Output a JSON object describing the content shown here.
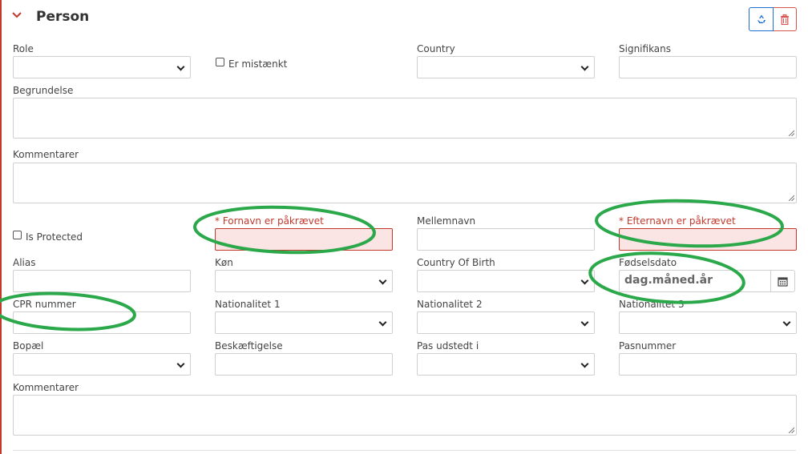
{
  "section": {
    "title": "Person"
  },
  "labels": {
    "role": "Role",
    "er_mistaenkt": "Er mistænkt",
    "country": "Country",
    "signifikans": "Signifikans",
    "begrundelse": "Begrundelse",
    "kommentarer_1": "Kommentarer",
    "is_protected": "Is Protected",
    "fornavn_required": "* Fornavn er påkrævet",
    "mellemnavn": "Mellemnavn",
    "efternavn_required": "* Efternavn er påkrævet",
    "alias": "Alias",
    "koen": "Køn",
    "country_of_birth": "Country Of Birth",
    "foedselsdato": "Fødselsdato",
    "cpr_nummer": "CPR nummer",
    "nationalitet_1": "Nationalitet 1",
    "nationalitet_2": "Nationalitet 2",
    "nationalitet_3": "Nationalitet 3",
    "bopael": "Bopæl",
    "beskaeftigelse": "Beskæftigelse",
    "pas_udstedt_i": "Pas udstedt i",
    "pasnummer": "Pasnummer",
    "kommentarer_2": "Kommentarer"
  },
  "date_field": {
    "placeholder": "dag.måned.år"
  },
  "icons": {
    "collapse": "chevron-down-icon",
    "recycle": "recycle-icon",
    "delete": "trash-icon",
    "calendar": "calendar-icon"
  },
  "colors": {
    "error": "#c0392b",
    "error_bg": "#fbe4e4",
    "primary": "#1e6fd1",
    "danger": "#d9534f",
    "annotation": "#2aa84a"
  }
}
